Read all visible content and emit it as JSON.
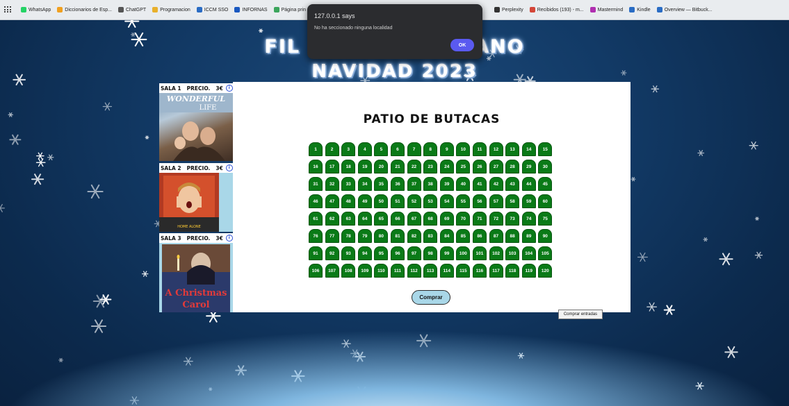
{
  "bookmarks": [
    {
      "label": "WhatsApp",
      "color": "#25d366"
    },
    {
      "label": "Diccionarios de Esp...",
      "color": "#f0a020"
    },
    {
      "label": "ChatGPT",
      "color": "#555555"
    },
    {
      "label": "Programacion",
      "color": "#e8b02c"
    },
    {
      "label": "ICCM SSO",
      "color": "#2a6cc4"
    },
    {
      "label": "INFORNAS",
      "color": "#1a58c0"
    },
    {
      "label": "Página prin",
      "color": "#3ba55c"
    },
    {
      "label": "Perplexity",
      "color": "#333333"
    },
    {
      "label": "Recibidos (193) - m...",
      "color": "#d44638"
    },
    {
      "label": "Mastermind",
      "color": "#b02fb0"
    },
    {
      "label": "Kindle",
      "color": "#2a6cc4"
    },
    {
      "label": "Overview — Bitbuck...",
      "color": "#2a6cc4"
    }
  ],
  "header": {
    "line1_left": "FIL",
    "line1_right": "ANO",
    "line2": "NAVIDAD 2023"
  },
  "salas": [
    {
      "name": "SALA 1",
      "precio_label": "PRECIO.",
      "price": "3€",
      "poster": "It's a Wonderful Life",
      "poster_text": "WONDERFUL LIFE"
    },
    {
      "name": "SALA 2",
      "precio_label": "PRECIO.",
      "price": "3€",
      "poster": "Home Alone",
      "poster_text": "HOME ALONE"
    },
    {
      "name": "SALA 3",
      "precio_label": "PRECIO.",
      "price": "3€",
      "poster": "A Christmas Carol",
      "poster_text": "A Christmas Carol"
    }
  ],
  "main": {
    "title": "PATIO DE BUTACAS",
    "seat_count": 120,
    "seat_color": "#0a7a17",
    "buy_button": "Comprar",
    "tooltip": "Comprar entradas"
  },
  "dialog": {
    "title": "127.0.0.1 says",
    "message": "No ha seccionado ninguna localidad",
    "ok": "OK"
  }
}
